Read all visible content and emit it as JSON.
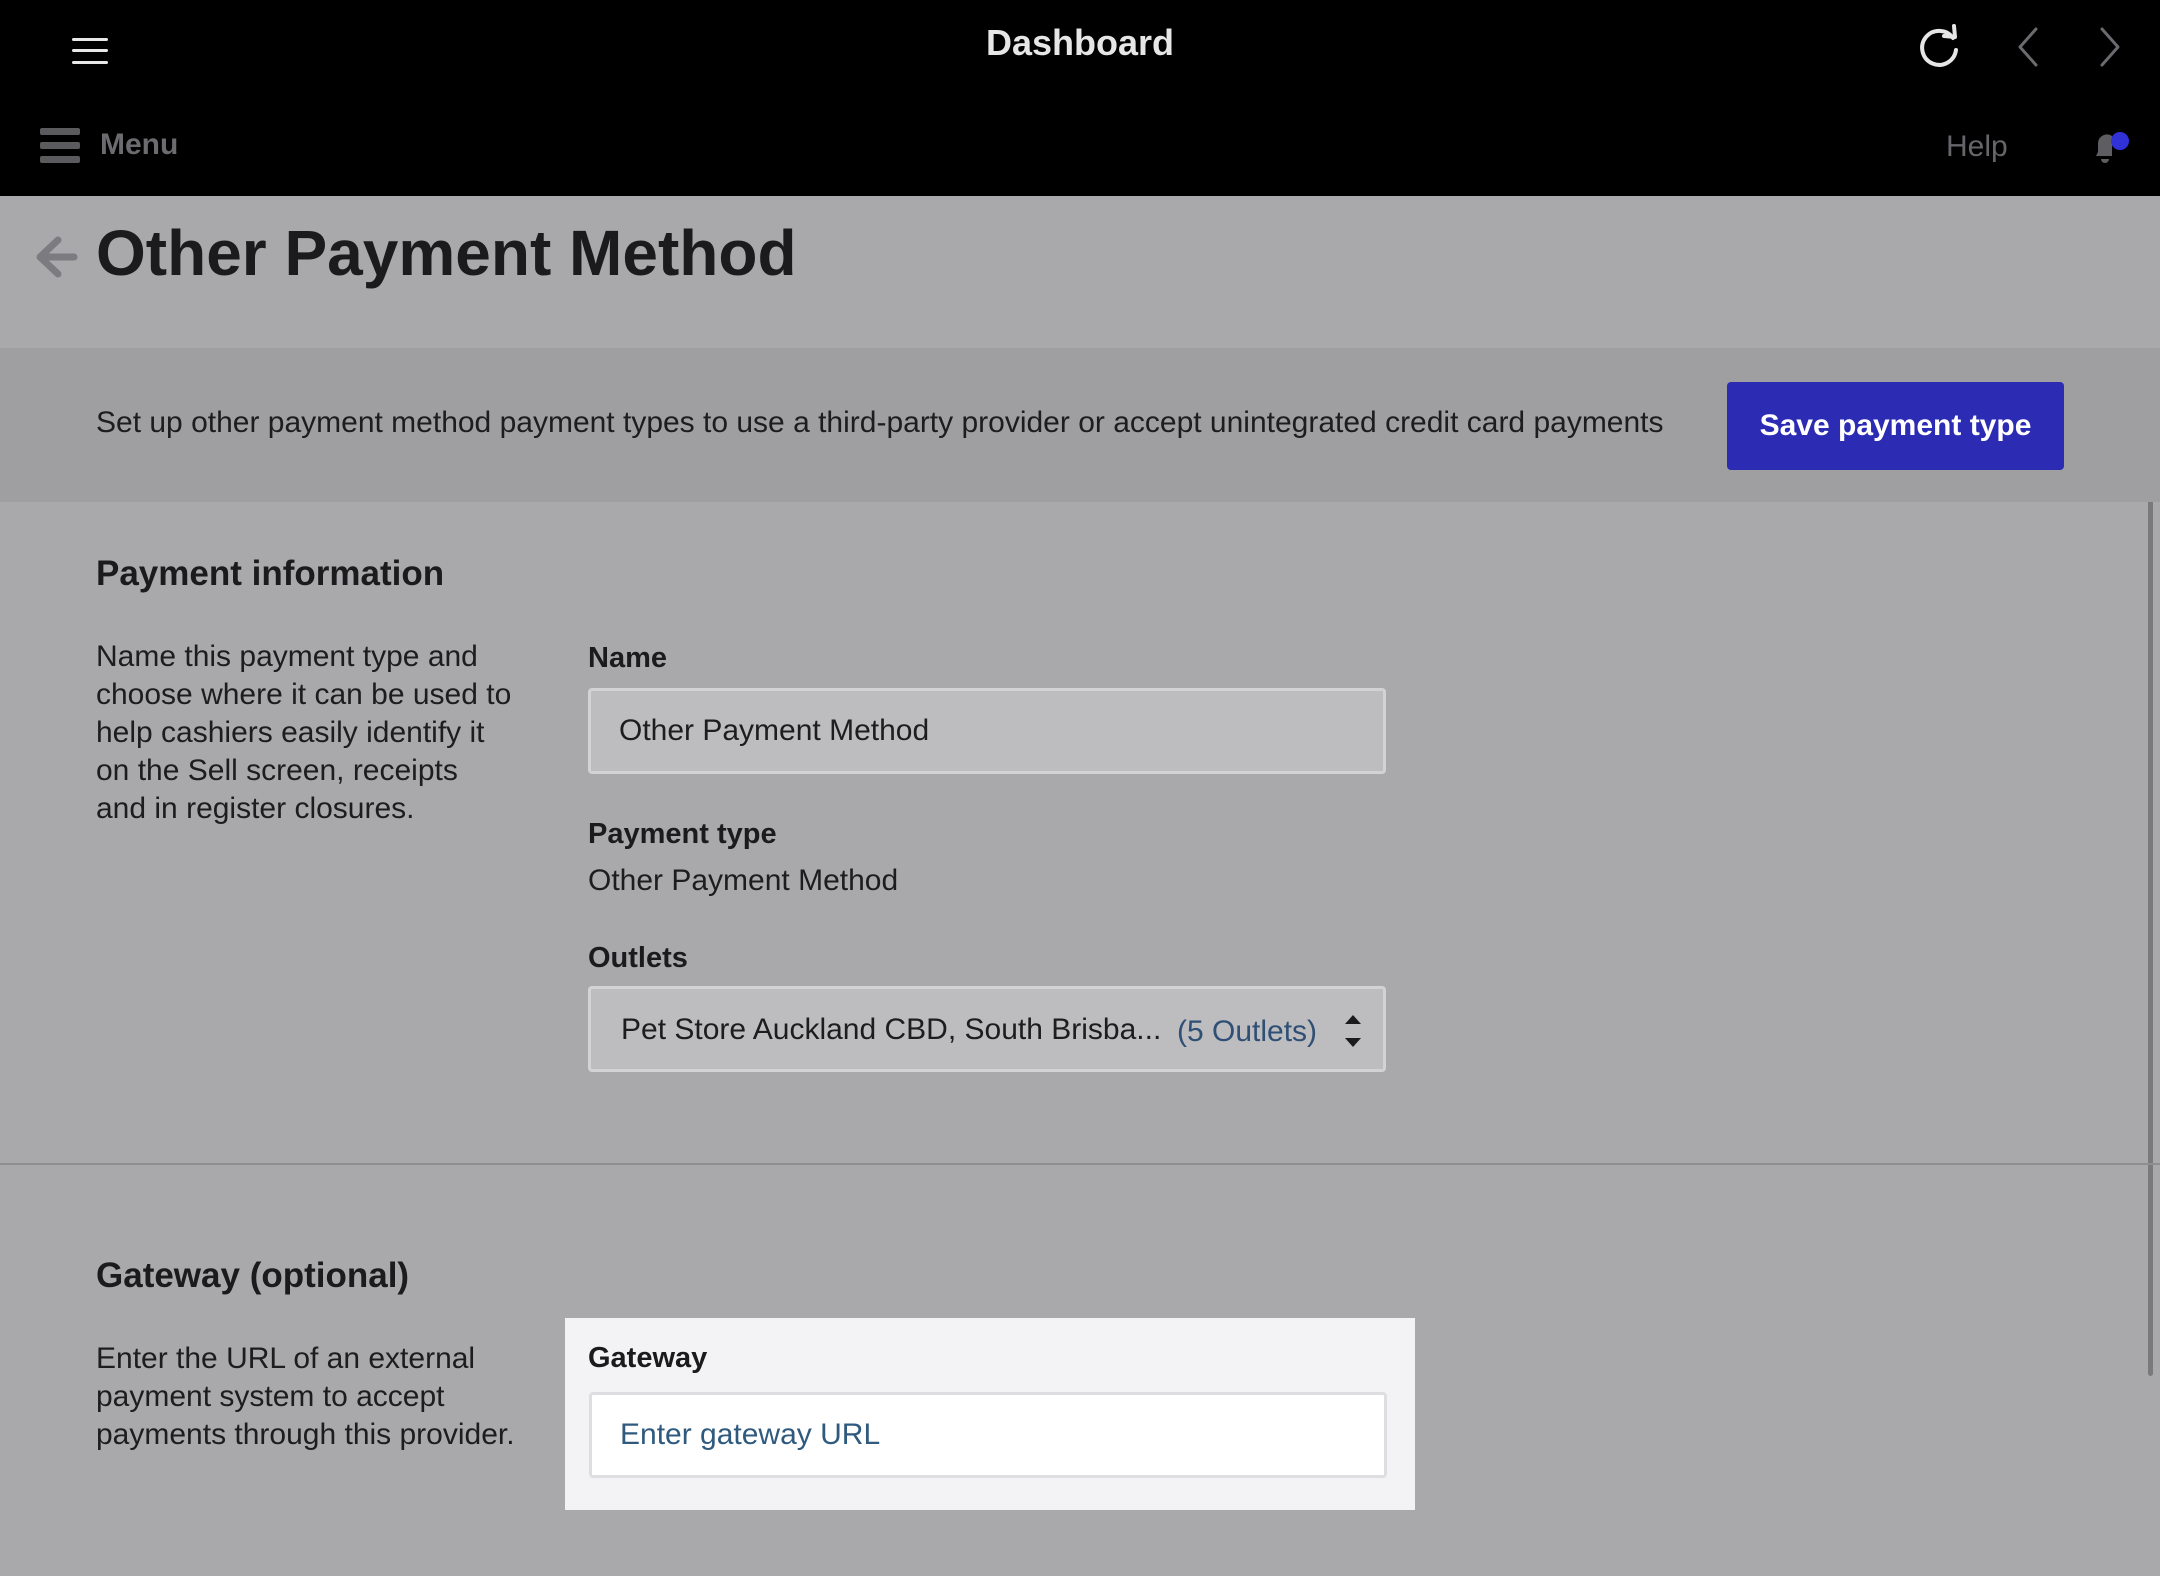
{
  "topbar": {
    "title": "Dashboard",
    "icons": [
      "hamburger-icon",
      "reload-icon",
      "chevron-left-icon",
      "chevron-right-icon"
    ]
  },
  "menu_bar": {
    "menu_label": "Menu",
    "help_label": "Help",
    "notification_dot_color": "#3131d8"
  },
  "page": {
    "title": "Other Payment Method",
    "intro": "Set up other payment method payment types to use a third-party provider or accept unintegrated credit card payments",
    "save_button": "Save payment type",
    "accent_color": "#2b2bb4"
  },
  "payment_info": {
    "title": "Payment information",
    "description": "Name this payment type and choose where it can be used to help cashiers easily identify it on the Sell screen, receipts and in register closures.",
    "name_label": "Name",
    "name_value": "Other Payment Method",
    "payment_type_label": "Payment type",
    "payment_type_value": "Other Payment Method",
    "outlets_label": "Outlets",
    "outlets_value": "Pet Store Auckland CBD, South Brisba...",
    "outlets_count": "(5 Outlets)"
  },
  "gateway": {
    "title": "Gateway (optional)",
    "description": "Enter the URL of an external payment system to accept payments through this provider.",
    "label": "Gateway",
    "placeholder": "Enter gateway URL"
  }
}
